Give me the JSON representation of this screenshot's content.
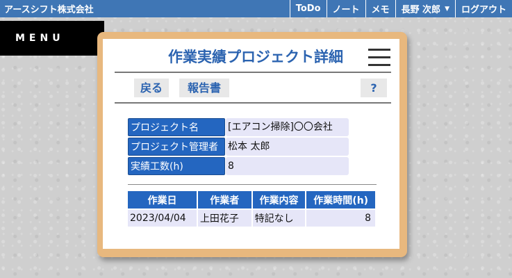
{
  "header": {
    "company": "アースシフト株式会社",
    "nav": [
      "ToDo",
      "ノート",
      "メモ",
      "長野 次郎",
      "ログアウト"
    ]
  },
  "menu": {
    "label": "MENU"
  },
  "page": {
    "title": "作業実績プロジェクト詳細",
    "buttons": {
      "back": "戻る",
      "report": "報告書",
      "help": "?"
    }
  },
  "info": [
    {
      "label": "プロジェクト名",
      "value": "[エアコン掃除]〇〇会社"
    },
    {
      "label": "プロジェクト管理者",
      "value": "松本 太郎"
    },
    {
      "label": "実績工数(h)",
      "value": "8"
    }
  ],
  "table": {
    "headers": [
      "作業日",
      "作業者",
      "作業内容",
      "作業時間(h)"
    ],
    "rows": [
      [
        "2023/04/04",
        "上田花子",
        "特記なし",
        "8"
      ]
    ]
  },
  "colors": {
    "header": "#3f76b5",
    "accent": "#2466c0",
    "frame": "#e8b87e"
  }
}
